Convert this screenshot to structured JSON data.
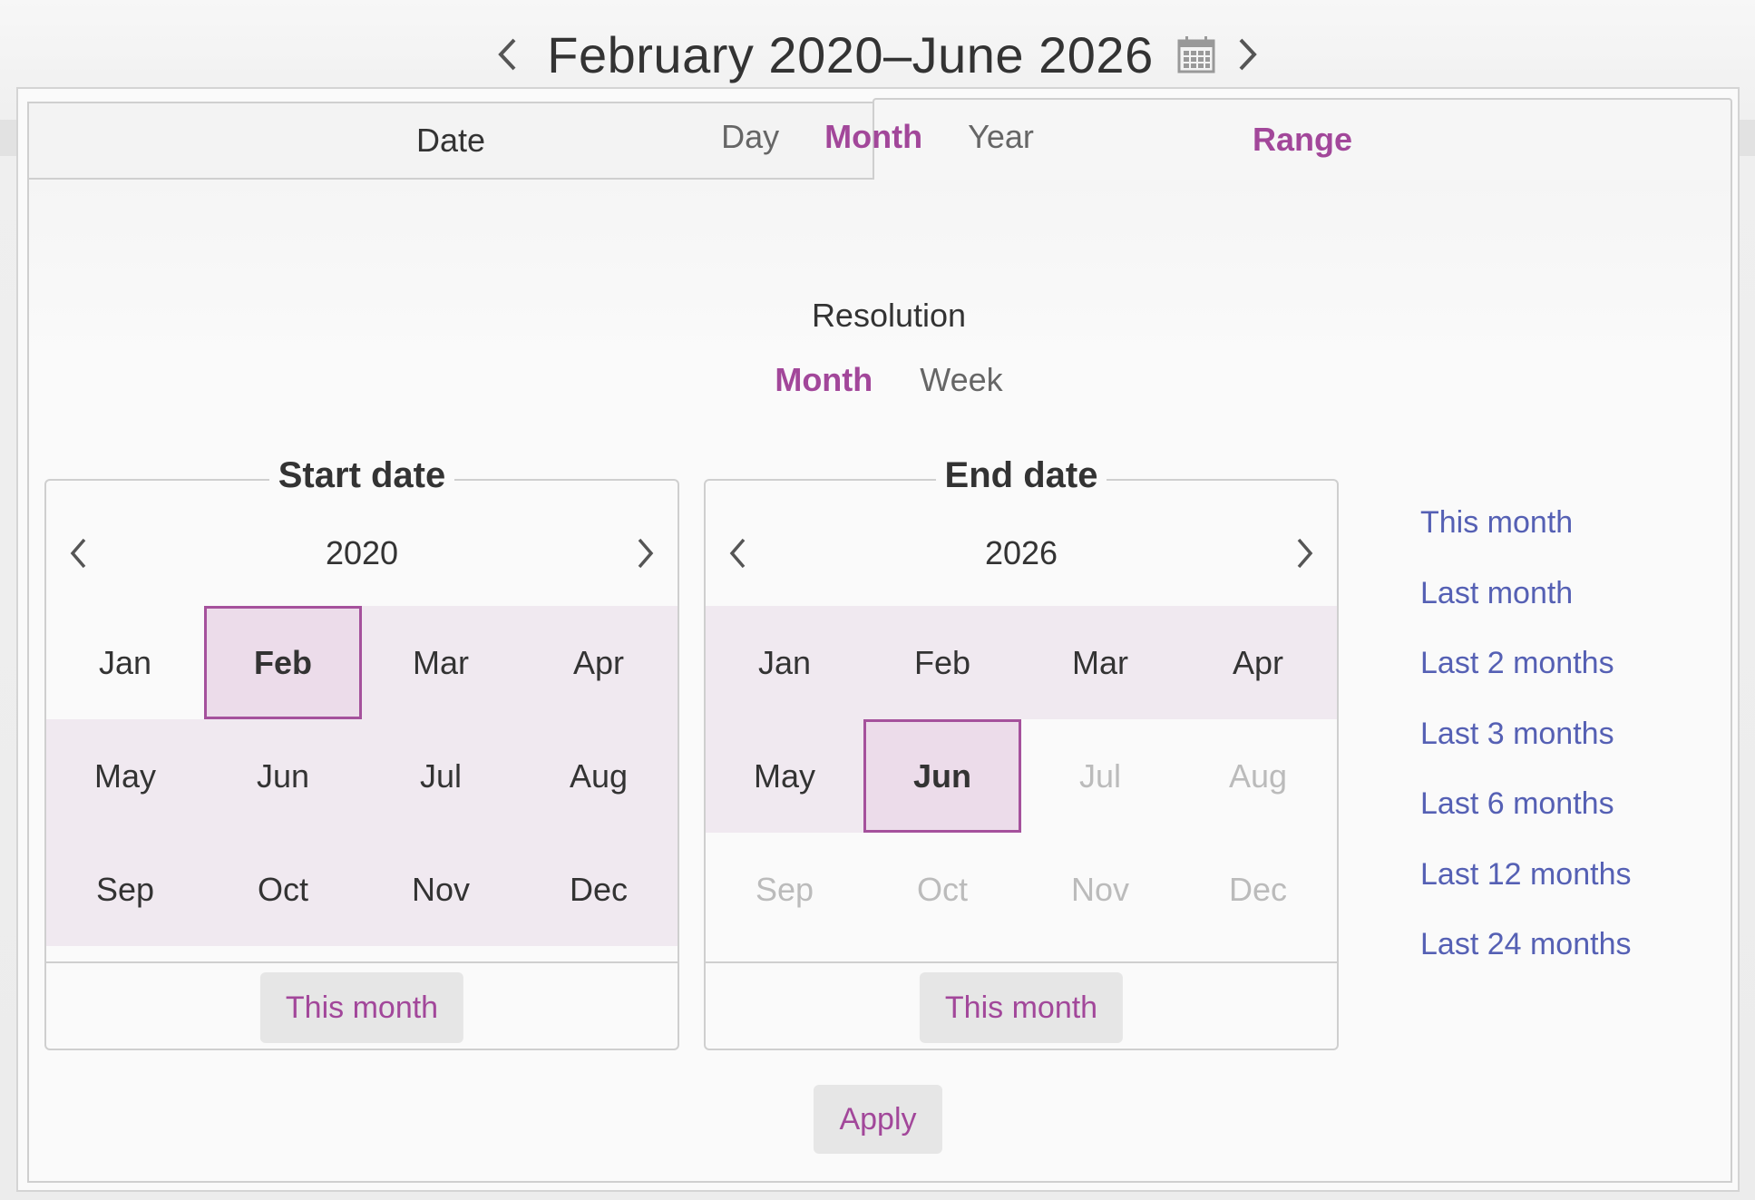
{
  "header": {
    "title": "February 2020–June 2026"
  },
  "tabs": [
    {
      "label": "Date"
    },
    {
      "label": "Range"
    }
  ],
  "mode": {
    "options": [
      "Day",
      "Month",
      "Year"
    ],
    "active": "Month"
  },
  "resolution": {
    "label": "Resolution",
    "options": [
      "Month",
      "Week"
    ],
    "active": "Month"
  },
  "start": {
    "legend": "Start date",
    "year": "2020",
    "months": [
      "Jan",
      "Feb",
      "Mar",
      "Apr",
      "May",
      "Jun",
      "Jul",
      "Aug",
      "Sep",
      "Oct",
      "Nov",
      "Dec"
    ],
    "selected": "Feb",
    "button": "This month"
  },
  "end": {
    "legend": "End date",
    "year": "2026",
    "months": [
      "Jan",
      "Feb",
      "Mar",
      "Apr",
      "May",
      "Jun",
      "Jul",
      "Aug",
      "Sep",
      "Oct",
      "Nov",
      "Dec"
    ],
    "selected": "Jun",
    "disabled": [
      "Jul",
      "Aug",
      "Sep",
      "Oct",
      "Nov",
      "Dec"
    ],
    "button": "This month"
  },
  "quick_ranges": [
    "This month",
    "Last month",
    "Last 2 months",
    "Last 3 months",
    "Last 6 months",
    "Last 12 months",
    "Last 24 months"
  ],
  "apply_label": "Apply",
  "colors": {
    "accent": "#a2479a",
    "link": "#5560b4",
    "range_fill": "#f0e9f0",
    "selected_fill": "#ecdcea"
  }
}
